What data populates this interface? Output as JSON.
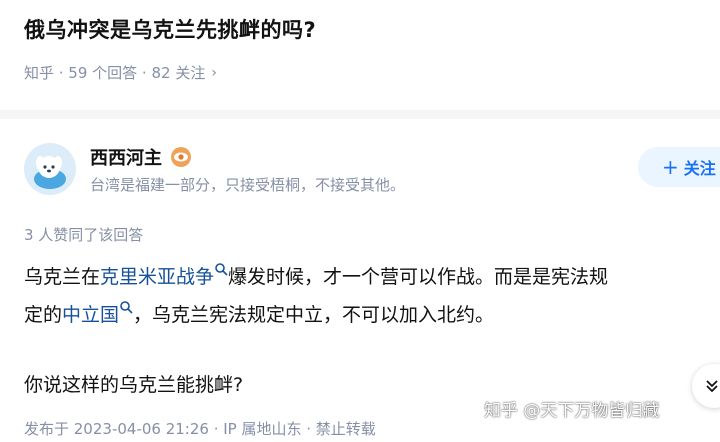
{
  "question": {
    "title": "俄乌冲突是乌克兰先挑衅的吗?",
    "meta": "知乎 · 59 个回答 · 82 关注"
  },
  "author": {
    "name": "西西河主",
    "bio": "台湾是福建一部分，只接受梧桐，不接受其他。"
  },
  "follow_button": {
    "label": "关注"
  },
  "answer": {
    "upvote_text": "3 人赞同了该回答",
    "line1_a": "乌克兰在",
    "link1": "克里米亚战争",
    "line1_b": "爆发时候，才一个营可以作战。而是是宪法规",
    "line2_a": "定的",
    "link2": "中立国",
    "line2_b": "，乌克兰宪法规定中立，不可以加入北约。",
    "para2": "你说这样的乌克兰能挑衅?",
    "footer": "发布于 2023-04-06 21:26 · IP 属地山东 · 禁止转载"
  },
  "watermark": "知乎 @天下万物皆归藏",
  "colors": {
    "accent": "#1772f6",
    "link": "#175199",
    "muted": "#8590a6"
  }
}
